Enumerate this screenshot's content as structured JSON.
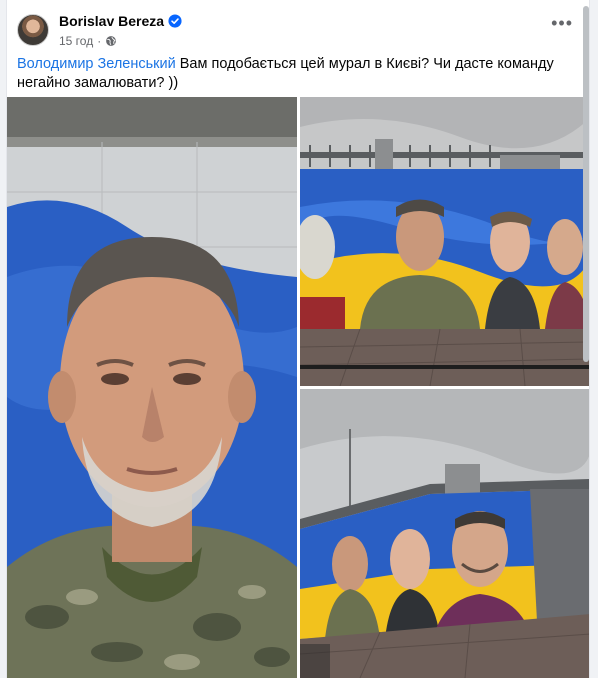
{
  "post": {
    "author": "Borislav Bereza",
    "time": "15 год",
    "separator": "·",
    "mention": "Володимир Зеленський",
    "text": " Вам подобається цей мурал в Києві? Чи дасте команду негайно замалювати? ))",
    "more_icon": "more-horizontal-icon"
  },
  "colors": {
    "mention": "#1b74e4",
    "verified": "#0866ff",
    "flag_blue": "#2a5fc4",
    "flag_yellow": "#f2c21d"
  },
  "photos": [
    {
      "name": "photo-1"
    },
    {
      "name": "photo-2"
    },
    {
      "name": "photo-3"
    }
  ]
}
